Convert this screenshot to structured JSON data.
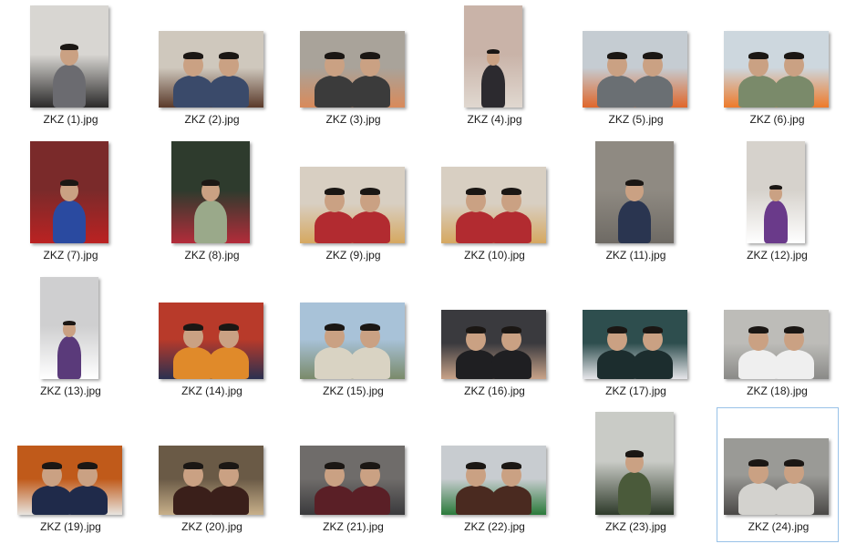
{
  "files": [
    {
      "name": "ZKZ (1).jpg",
      "colors": [
        "#d8d6d2",
        "#6b6b70",
        "#2b2a2a"
      ]
    },
    {
      "name": "ZKZ (2).jpg",
      "colors": [
        "#cfc8bd",
        "#3a4a6a",
        "#5a3a2a"
      ]
    },
    {
      "name": "ZKZ (3).jpg",
      "colors": [
        "#a9a39a",
        "#3b3b3b",
        "#d98a5a"
      ]
    },
    {
      "name": "ZKZ (4).jpg",
      "colors": [
        "#c9b3a8",
        "#2c2a2f",
        "#e0d8d0"
      ]
    },
    {
      "name": "ZKZ (5).jpg",
      "colors": [
        "#c5ccd2",
        "#6a6f73",
        "#e0662a"
      ]
    },
    {
      "name": "ZKZ (6).jpg",
      "colors": [
        "#cdd7de",
        "#7a8a6a",
        "#ee7a2a"
      ]
    },
    {
      "name": "ZKZ (7).jpg",
      "colors": [
        "#7a2a2a",
        "#2a4aa0",
        "#b22"
      ]
    },
    {
      "name": "ZKZ (8).jpg",
      "colors": [
        "#2e3b2d",
        "#9aa98a",
        "#b32c3a"
      ]
    },
    {
      "name": "ZKZ (9).jpg",
      "colors": [
        "#d8cfc2",
        "#b22b30",
        "#d6a860"
      ]
    },
    {
      "name": "ZKZ (10).jpg",
      "colors": [
        "#d8cfc2",
        "#b22b30",
        "#d6a860"
      ]
    },
    {
      "name": "ZKZ (11).jpg",
      "colors": [
        "#8f8a82",
        "#2a3550",
        "#6e6a64"
      ]
    },
    {
      "name": "ZKZ (12).jpg",
      "colors": [
        "#d6d2cc",
        "#6a3a8a",
        "#ffffff"
      ]
    },
    {
      "name": "ZKZ (13).jpg",
      "colors": [
        "#cfcfd0",
        "#5a3a7a",
        "#ffffff"
      ]
    },
    {
      "name": "ZKZ (14).jpg",
      "colors": [
        "#b83a2a",
        "#e08a2a",
        "#2a3050"
      ]
    },
    {
      "name": "ZKZ (15).jpg",
      "colors": [
        "#a8c2d8",
        "#d9d3c3",
        "#7a8a6a"
      ]
    },
    {
      "name": "ZKZ (16).jpg",
      "colors": [
        "#3a3a3e",
        "#1f1f22",
        "#c9a389"
      ]
    },
    {
      "name": "ZKZ (17).jpg",
      "colors": [
        "#2e4e4e",
        "#1c2d2e",
        "#e6e6ea"
      ]
    },
    {
      "name": "ZKZ (18).jpg",
      "colors": [
        "#bdbcb8",
        "#efefef",
        "#8a8a88"
      ]
    },
    {
      "name": "ZKZ (19).jpg",
      "colors": [
        "#c05a1a",
        "#1f2a4a",
        "#e7e4de"
      ]
    },
    {
      "name": "ZKZ (20).jpg",
      "colors": [
        "#6a5a46",
        "#3a1f1a",
        "#c8b08a"
      ]
    },
    {
      "name": "ZKZ (21).jpg",
      "colors": [
        "#6f6c6a",
        "#5a1f26",
        "#3a3a3c"
      ]
    },
    {
      "name": "ZKZ (22).jpg",
      "colors": [
        "#c8ccd0",
        "#4a2a20",
        "#2a7a3a"
      ]
    },
    {
      "name": "ZKZ (23).jpg",
      "colors": [
        "#c9cbc6",
        "#4a5a3a",
        "#2e3a2a"
      ]
    },
    {
      "name": "ZKZ (24).jpg",
      "colors": [
        "#9a9a96",
        "#d3d2ce",
        "#4a4846"
      ]
    }
  ]
}
